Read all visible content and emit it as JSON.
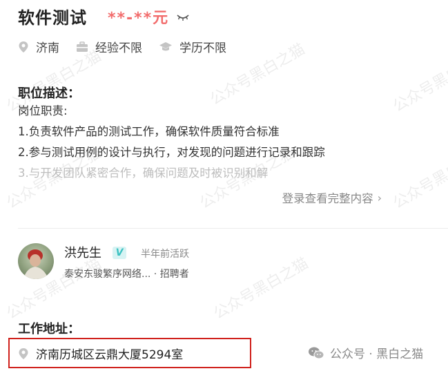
{
  "job": {
    "title": "软件测试",
    "salary": "**-**元",
    "location": "济南",
    "experience": "经验不限",
    "education": "学历不限"
  },
  "description": {
    "heading": "职位描述：",
    "intro": "岗位职责:",
    "lines": [
      "1.负责软件产品的测试工作，确保软件质量符合标准",
      "2.参与测试用例的设计与执行，对发现的问题进行记录和跟踪",
      "3.与开发团队紧密合作，确保问题及时被识别和解"
    ],
    "more_link": "登录查看完整内容"
  },
  "recruiter": {
    "name": "洪先生",
    "badge": "V",
    "active": "半年前活跃",
    "company": "泰安东骏繁序网络... · 招聘者"
  },
  "address": {
    "heading": "工作地址：",
    "value": "济南历城区云鼎大厦5294室"
  },
  "watermark": {
    "text": "公众号黑白之猫",
    "footer": "公众号 · 黑白之猫"
  }
}
